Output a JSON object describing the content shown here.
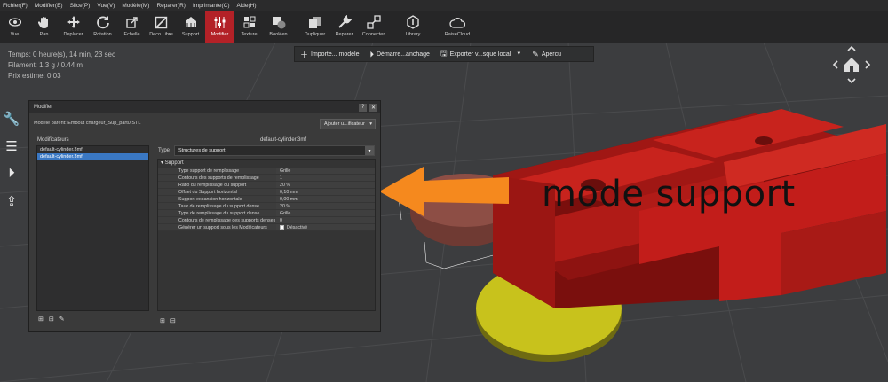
{
  "menu": [
    "Fichier(F)",
    "Modifier(E)",
    "Slice(P)",
    "Vue(V)",
    "Modèle(M)",
    "Reparer(R)",
    "Imprimante(C)",
    "Aide(H)"
  ],
  "toolbar": [
    {
      "label": "Vue",
      "icon": "eye-icon"
    },
    {
      "label": "Pan",
      "icon": "hand-icon"
    },
    {
      "label": "Deplacer",
      "icon": "move-icon"
    },
    {
      "label": "Rotation",
      "icon": "rotate-icon"
    },
    {
      "label": "Echelle",
      "icon": "scale-icon"
    },
    {
      "label": "Deco...ibre",
      "icon": "cut-icon"
    },
    {
      "label": "Support",
      "icon": "support-icon"
    },
    {
      "label": "Modifier",
      "icon": "modifier-icon",
      "active": true
    },
    {
      "label": "Texture",
      "icon": "texture-icon"
    },
    {
      "label": "Booléen",
      "icon": "boolean-icon"
    },
    {
      "label": "Dupliquer",
      "icon": "duplicate-icon"
    },
    {
      "label": "Reparer",
      "icon": "repair-icon"
    },
    {
      "label": "Connecter",
      "icon": "connect-icon"
    },
    {
      "label": "Library",
      "icon": "library-icon"
    },
    {
      "label": "RaiseCloud",
      "icon": "cloud-icon"
    }
  ],
  "stats": {
    "time": "Temps: 0 heure(s), 14 min, 23 sec",
    "filament": "Filament: 1.3 g / 0.44 m",
    "price": "Prix estime: 0.03"
  },
  "actionbar": {
    "import": "Importe... modèle",
    "start": "Démarre...anchage",
    "export": "Exporter v...sque local",
    "preview": "Apercu"
  },
  "dialog": {
    "title": "Modifier",
    "help_btn": "?",
    "close_btn": "✕",
    "parent_model": "Modèle parent: Embout chargeur_Sup_part0.STL",
    "add_button": "Ajouter u...ificateur",
    "modifiers_heading": "Modificateurs",
    "modifiers": [
      "default-cylinder.3mf",
      "default-cylinder.3mf"
    ],
    "selected_index": 1,
    "object_name": "default-cylinder.3mf",
    "type_label": "Type",
    "type_value": "Structures de support",
    "section_title": "Support",
    "properties": [
      {
        "k": "Type support de remplissage",
        "v": "Grille"
      },
      {
        "k": "Contours des supports de remplissage",
        "v": "1"
      },
      {
        "k": "Ratio du remplissage du support",
        "v": "20 %"
      },
      {
        "k": "Offset du Support horizontal",
        "v": "0,10 mm"
      },
      {
        "k": "Support expansion horizontale",
        "v": "0,00 mm"
      },
      {
        "k": "Taux de remplissage du support dense",
        "v": "20 %"
      },
      {
        "k": "Type de remplissage du support dense",
        "v": "Grille"
      },
      {
        "k": "Contours de remplissage des supports denses",
        "v": "0"
      },
      {
        "k": "Générer un support sous les Modificateurs",
        "v": "Désactivé",
        "checkbox": true
      }
    ]
  },
  "annotation": "mode support",
  "colors": {
    "accent": "#b32127",
    "model_red": "#c21d1a",
    "plate_yellow": "#c8c21c",
    "cylinder_brown": "#8d4e45",
    "arrow": "#f5891e",
    "selection": "#3a78c4"
  }
}
